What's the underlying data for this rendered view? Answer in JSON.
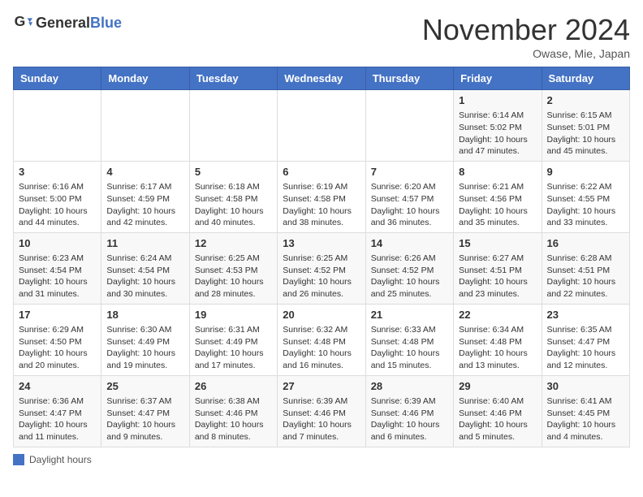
{
  "header": {
    "logo_general": "General",
    "logo_blue": "Blue",
    "title": "November 2024",
    "location": "Owase, Mie, Japan"
  },
  "days_of_week": [
    "Sunday",
    "Monday",
    "Tuesday",
    "Wednesday",
    "Thursday",
    "Friday",
    "Saturday"
  ],
  "legend": {
    "label": "Daylight hours"
  },
  "weeks": [
    [
      {
        "day": "",
        "data": ""
      },
      {
        "day": "",
        "data": ""
      },
      {
        "day": "",
        "data": ""
      },
      {
        "day": "",
        "data": ""
      },
      {
        "day": "",
        "data": ""
      },
      {
        "day": "1",
        "data": "Sunrise: 6:14 AM\nSunset: 5:02 PM\nDaylight: 10 hours and 47 minutes."
      },
      {
        "day": "2",
        "data": "Sunrise: 6:15 AM\nSunset: 5:01 PM\nDaylight: 10 hours and 45 minutes."
      }
    ],
    [
      {
        "day": "3",
        "data": "Sunrise: 6:16 AM\nSunset: 5:00 PM\nDaylight: 10 hours and 44 minutes."
      },
      {
        "day": "4",
        "data": "Sunrise: 6:17 AM\nSunset: 4:59 PM\nDaylight: 10 hours and 42 minutes."
      },
      {
        "day": "5",
        "data": "Sunrise: 6:18 AM\nSunset: 4:58 PM\nDaylight: 10 hours and 40 minutes."
      },
      {
        "day": "6",
        "data": "Sunrise: 6:19 AM\nSunset: 4:58 PM\nDaylight: 10 hours and 38 minutes."
      },
      {
        "day": "7",
        "data": "Sunrise: 6:20 AM\nSunset: 4:57 PM\nDaylight: 10 hours and 36 minutes."
      },
      {
        "day": "8",
        "data": "Sunrise: 6:21 AM\nSunset: 4:56 PM\nDaylight: 10 hours and 35 minutes."
      },
      {
        "day": "9",
        "data": "Sunrise: 6:22 AM\nSunset: 4:55 PM\nDaylight: 10 hours and 33 minutes."
      }
    ],
    [
      {
        "day": "10",
        "data": "Sunrise: 6:23 AM\nSunset: 4:54 PM\nDaylight: 10 hours and 31 minutes."
      },
      {
        "day": "11",
        "data": "Sunrise: 6:24 AM\nSunset: 4:54 PM\nDaylight: 10 hours and 30 minutes."
      },
      {
        "day": "12",
        "data": "Sunrise: 6:25 AM\nSunset: 4:53 PM\nDaylight: 10 hours and 28 minutes."
      },
      {
        "day": "13",
        "data": "Sunrise: 6:25 AM\nSunset: 4:52 PM\nDaylight: 10 hours and 26 minutes."
      },
      {
        "day": "14",
        "data": "Sunrise: 6:26 AM\nSunset: 4:52 PM\nDaylight: 10 hours and 25 minutes."
      },
      {
        "day": "15",
        "data": "Sunrise: 6:27 AM\nSunset: 4:51 PM\nDaylight: 10 hours and 23 minutes."
      },
      {
        "day": "16",
        "data": "Sunrise: 6:28 AM\nSunset: 4:51 PM\nDaylight: 10 hours and 22 minutes."
      }
    ],
    [
      {
        "day": "17",
        "data": "Sunrise: 6:29 AM\nSunset: 4:50 PM\nDaylight: 10 hours and 20 minutes."
      },
      {
        "day": "18",
        "data": "Sunrise: 6:30 AM\nSunset: 4:49 PM\nDaylight: 10 hours and 19 minutes."
      },
      {
        "day": "19",
        "data": "Sunrise: 6:31 AM\nSunset: 4:49 PM\nDaylight: 10 hours and 17 minutes."
      },
      {
        "day": "20",
        "data": "Sunrise: 6:32 AM\nSunset: 4:48 PM\nDaylight: 10 hours and 16 minutes."
      },
      {
        "day": "21",
        "data": "Sunrise: 6:33 AM\nSunset: 4:48 PM\nDaylight: 10 hours and 15 minutes."
      },
      {
        "day": "22",
        "data": "Sunrise: 6:34 AM\nSunset: 4:48 PM\nDaylight: 10 hours and 13 minutes."
      },
      {
        "day": "23",
        "data": "Sunrise: 6:35 AM\nSunset: 4:47 PM\nDaylight: 10 hours and 12 minutes."
      }
    ],
    [
      {
        "day": "24",
        "data": "Sunrise: 6:36 AM\nSunset: 4:47 PM\nDaylight: 10 hours and 11 minutes."
      },
      {
        "day": "25",
        "data": "Sunrise: 6:37 AM\nSunset: 4:47 PM\nDaylight: 10 hours and 9 minutes."
      },
      {
        "day": "26",
        "data": "Sunrise: 6:38 AM\nSunset: 4:46 PM\nDaylight: 10 hours and 8 minutes."
      },
      {
        "day": "27",
        "data": "Sunrise: 6:39 AM\nSunset: 4:46 PM\nDaylight: 10 hours and 7 minutes."
      },
      {
        "day": "28",
        "data": "Sunrise: 6:39 AM\nSunset: 4:46 PM\nDaylight: 10 hours and 6 minutes."
      },
      {
        "day": "29",
        "data": "Sunrise: 6:40 AM\nSunset: 4:46 PM\nDaylight: 10 hours and 5 minutes."
      },
      {
        "day": "30",
        "data": "Sunrise: 6:41 AM\nSunset: 4:45 PM\nDaylight: 10 hours and 4 minutes."
      }
    ]
  ]
}
